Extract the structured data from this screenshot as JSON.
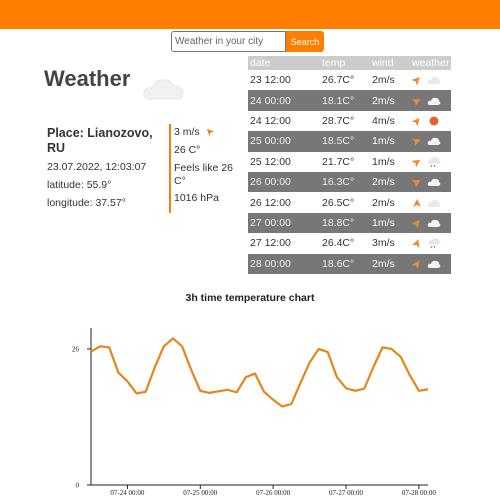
{
  "search": {
    "placeholder": "Weather in your city",
    "button_label": "Search"
  },
  "title": "Weather",
  "place": "Place: Lianozovo, RU",
  "datetime": "23.07.2022, 12:03:07",
  "latitude": "latitude: 55.9°",
  "longitude": "longitude: 37.57°",
  "current": {
    "wind": "3 m/s",
    "temp": "26 C°",
    "feels_like": "Feels like 26 C°",
    "pressure": "1016 hPa"
  },
  "forecast": {
    "headers": [
      "date",
      "temp",
      "wind",
      "weather"
    ],
    "rows": [
      {
        "date": "23 12:00",
        "temp": "26.7C°",
        "wind": "2m/s",
        "wind_icon": "arrow-icon",
        "weather_icon": "cloud-icon"
      },
      {
        "date": "24 00:00",
        "temp": "18.1C°",
        "wind": "2m/s",
        "wind_icon": "arrow-icon",
        "weather_icon": "cloud-icon"
      },
      {
        "date": "24 12:00",
        "temp": "28.7C°",
        "wind": "4m/s",
        "wind_icon": "arrow-icon",
        "weather_icon": "sun-icon"
      },
      {
        "date": "25 00:00",
        "temp": "18.5C°",
        "wind": "1m/s",
        "wind_icon": "arrow-icon",
        "weather_icon": "cloud-icon"
      },
      {
        "date": "25 12:00",
        "temp": "21.7C°",
        "wind": "1m/s",
        "wind_icon": "arrow-icon",
        "weather_icon": "rain-icon"
      },
      {
        "date": "26 00:00",
        "temp": "16.3C°",
        "wind": "2m/s",
        "wind_icon": "arrow-icon",
        "weather_icon": "cloud-icon"
      },
      {
        "date": "26 12:00",
        "temp": "26.5C°",
        "wind": "2m/s",
        "wind_icon": "arrow-icon",
        "weather_icon": "cloud-icon"
      },
      {
        "date": "27 00:00",
        "temp": "18.8C°",
        "wind": "1m/s",
        "wind_icon": "arrow-icon",
        "weather_icon": "cloud-icon"
      },
      {
        "date": "27 12:00",
        "temp": "26.4C°",
        "wind": "3m/s",
        "wind_icon": "arrow-icon",
        "weather_icon": "rain-icon"
      },
      {
        "date": "28 00:00",
        "temp": "18.6C°",
        "wind": "2m/s",
        "wind_icon": "arrow-icon",
        "weather_icon": "cloud-icon"
      }
    ]
  },
  "colors": {
    "accent": "#ff7d00",
    "line": "#e8851a",
    "sun": "#e2603a"
  },
  "chart_data": {
    "type": "line",
    "title": "3h time temperature chart",
    "x": [
      "2022-07-23 12:00",
      "2022-07-23 15:00",
      "2022-07-23 18:00",
      "2022-07-23 21:00",
      "2022-07-24 00:00",
      "2022-07-24 03:00",
      "2022-07-24 06:00",
      "2022-07-24 09:00",
      "2022-07-24 12:00",
      "2022-07-24 15:00",
      "2022-07-24 18:00",
      "2022-07-24 21:00",
      "2022-07-25 00:00",
      "2022-07-25 03:00",
      "2022-07-25 06:00",
      "2022-07-25 09:00",
      "2022-07-25 12:00",
      "2022-07-25 15:00",
      "2022-07-25 18:00",
      "2022-07-25 21:00",
      "2022-07-26 00:00",
      "2022-07-26 03:00",
      "2022-07-26 06:00",
      "2022-07-26 09:00",
      "2022-07-26 12:00",
      "2022-07-26 15:00",
      "2022-07-26 18:00",
      "2022-07-26 21:00",
      "2022-07-27 00:00",
      "2022-07-27 03:00",
      "2022-07-27 06:00",
      "2022-07-27 09:00",
      "2022-07-27 12:00",
      "2022-07-27 15:00",
      "2022-07-27 18:00",
      "2022-07-27 21:00",
      "2022-07-28 00:00",
      "2022-07-28 03:00"
    ],
    "values": [
      25.5,
      26.5,
      26.3,
      21.5,
      19.8,
      17.5,
      17.8,
      22.5,
      26.5,
      28.0,
      26.5,
      22.0,
      18.0,
      17.6,
      17.9,
      18.2,
      17.7,
      20.6,
      21.3,
      17.8,
      16.3,
      15.0,
      15.5,
      19.5,
      23.4,
      26.0,
      25.4,
      20.6,
      18.5,
      18.0,
      18.4,
      22.5,
      26.3,
      26.0,
      24.5,
      21.0,
      18.0,
      18.3
    ],
    "y_ticks": [
      0,
      26
    ],
    "x_ticks": [
      "07-24 00:00",
      "07-25 00:00",
      "07-26 00:00",
      "07-27 00:00",
      "07-28 00:00"
    ],
    "ylim": [
      0,
      30
    ],
    "grid": false,
    "xlabel": "",
    "ylabel": ""
  }
}
